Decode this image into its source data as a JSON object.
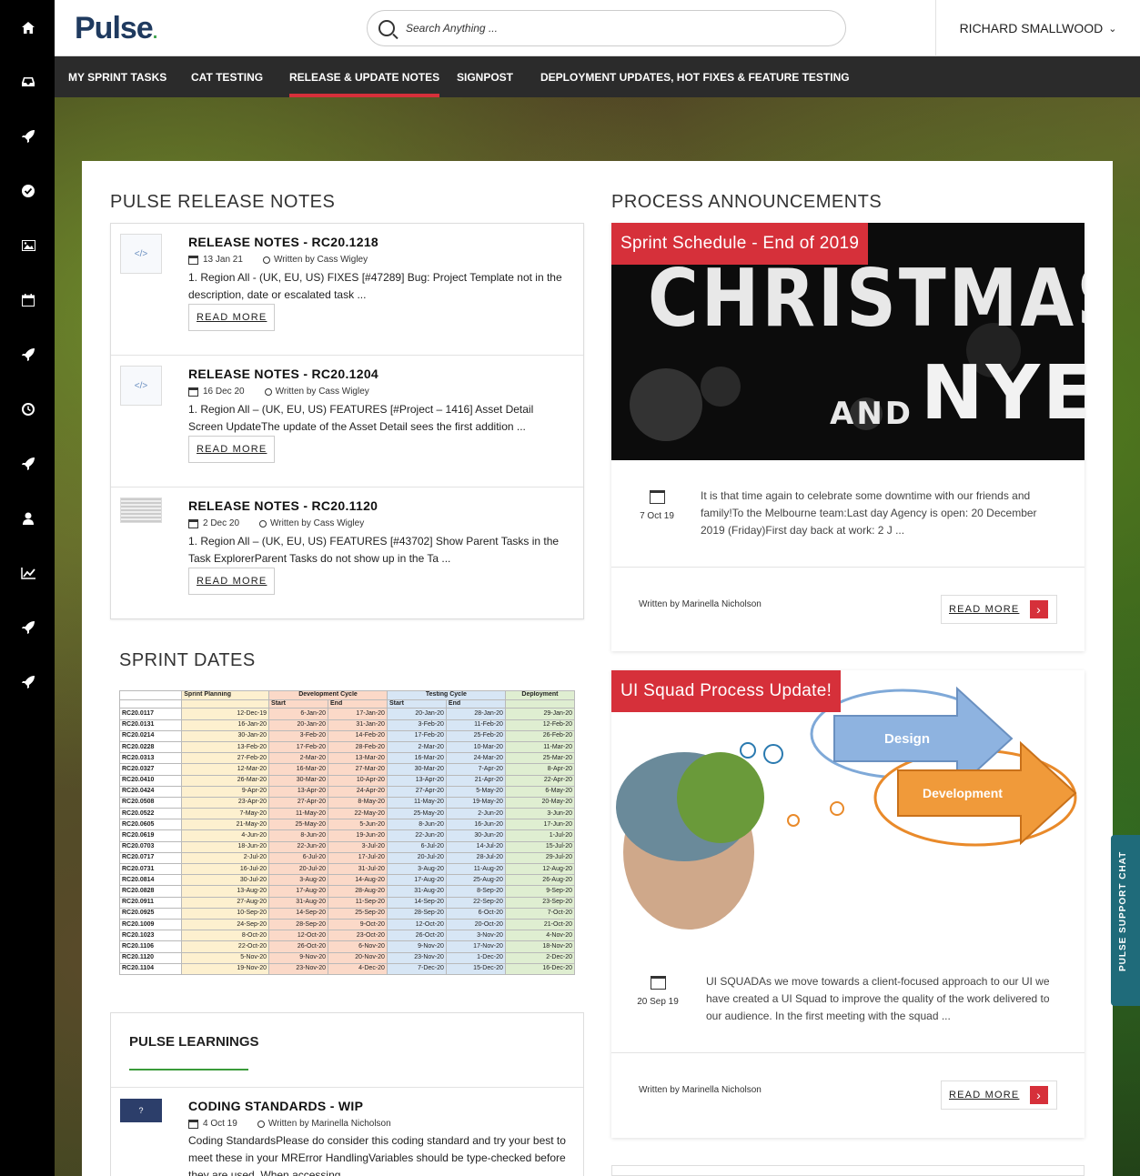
{
  "app": {
    "logo": "Pulse"
  },
  "search": {
    "placeholder": "Search Anything ..."
  },
  "user": {
    "name": "RICHARD SMALLWOOD"
  },
  "nav": {
    "items": [
      {
        "label": "MY SPRINT TASKS"
      },
      {
        "label": "CAT TESTING"
      },
      {
        "label": "RELEASE & UPDATE NOTES"
      },
      {
        "label": "SIGNPOST"
      },
      {
        "label": "DEPLOYMENT UPDATES, HOT FIXES & FEATURE TESTING"
      }
    ],
    "active_index": 2
  },
  "rail": {
    "icons": [
      "home-icon",
      "inbox-icon",
      "rocket-icon",
      "check-circle-icon",
      "image-icon",
      "calendar-icon",
      "rocket-icon",
      "clock-icon",
      "rocket-icon",
      "user-icon",
      "chart-line-icon",
      "rocket-icon",
      "rocket-icon"
    ]
  },
  "release_notes": {
    "title": "PULSE RELEASE NOTES",
    "read_more": "READ MORE",
    "items": [
      {
        "title": "RELEASE NOTES - RC20.1218",
        "date": "13 Jan 21",
        "author": "Written by Cass Wigley",
        "excerpt": "1. Region All - (UK, EU, US)  FIXES  [#47289] Bug: Project Template not in the description, date or escalated task ..."
      },
      {
        "title": "RELEASE NOTES - RC20.1204",
        "date": "16 Dec 20",
        "author": "Written by Cass Wigley",
        "excerpt": "1. Region All – (UK, EU, US) FEATURES [#Project – 1416] Asset Detail Screen UpdateThe update of the Asset Detail sees the first addition ..."
      },
      {
        "title": "RELEASE NOTES - RC20.1120",
        "date": "2 Dec 20",
        "author": "Written by Cass Wigley",
        "excerpt": "1. Region All – (UK, EU, US) FEATURES [#43702] Show Parent Tasks in the Task ExplorerParent Tasks do not show up in the Ta ..."
      }
    ]
  },
  "sprint_dates": {
    "title": "SPRINT DATES",
    "headers": {
      "planning": "Sprint Planning",
      "dev": "Development Cycle",
      "testing": "Testing Cycle",
      "deployment": "Deployment",
      "start": "Start",
      "end": "End"
    },
    "rows": [
      [
        "RC20.0117",
        "12-Dec-19",
        "6-Jan-20",
        "17-Jan-20",
        "20-Jan-20",
        "28-Jan-20",
        "29-Jan-20"
      ],
      [
        "RC20.0131",
        "16-Jan-20",
        "20-Jan-20",
        "31-Jan-20",
        "3-Feb-20",
        "11-Feb-20",
        "12-Feb-20"
      ],
      [
        "RC20.0214",
        "30-Jan-20",
        "3-Feb-20",
        "14-Feb-20",
        "17-Feb-20",
        "25-Feb-20",
        "26-Feb-20"
      ],
      [
        "RC20.0228",
        "13-Feb-20",
        "17-Feb-20",
        "28-Feb-20",
        "2-Mar-20",
        "10-Mar-20",
        "11-Mar-20"
      ],
      [
        "RC20.0313",
        "27-Feb-20",
        "2-Mar-20",
        "13-Mar-20",
        "16-Mar-20",
        "24-Mar-20",
        "25-Mar-20"
      ],
      [
        "RC20.0327",
        "12-Mar-20",
        "16-Mar-20",
        "27-Mar-20",
        "30-Mar-20",
        "7-Apr-20",
        "8-Apr-20"
      ],
      [
        "RC20.0410",
        "26-Mar-20",
        "30-Mar-20",
        "10-Apr-20",
        "13-Apr-20",
        "21-Apr-20",
        "22-Apr-20"
      ],
      [
        "RC20.0424",
        "9-Apr-20",
        "13-Apr-20",
        "24-Apr-20",
        "27-Apr-20",
        "5-May-20",
        "6-May-20"
      ],
      [
        "RC20.0508",
        "23-Apr-20",
        "27-Apr-20",
        "8-May-20",
        "11-May-20",
        "19-May-20",
        "20-May-20"
      ],
      [
        "RC20.0522",
        "7-May-20",
        "11-May-20",
        "22-May-20",
        "25-May-20",
        "2-Jun-20",
        "3-Jun-20"
      ],
      [
        "RC20.0605",
        "21-May-20",
        "25-May-20",
        "5-Jun-20",
        "8-Jun-20",
        "16-Jun-20",
        "17-Jun-20"
      ],
      [
        "RC20.0619",
        "4-Jun-20",
        "8-Jun-20",
        "19-Jun-20",
        "22-Jun-20",
        "30-Jun-20",
        "1-Jul-20"
      ],
      [
        "RC20.0703",
        "18-Jun-20",
        "22-Jun-20",
        "3-Jul-20",
        "6-Jul-20",
        "14-Jul-20",
        "15-Jul-20"
      ],
      [
        "RC20.0717",
        "2-Jul-20",
        "6-Jul-20",
        "17-Jul-20",
        "20-Jul-20",
        "28-Jul-20",
        "29-Jul-20"
      ],
      [
        "RC20.0731",
        "16-Jul-20",
        "20-Jul-20",
        "31-Jul-20",
        "3-Aug-20",
        "11-Aug-20",
        "12-Aug-20"
      ],
      [
        "RC20.0814",
        "30-Jul-20",
        "3-Aug-20",
        "14-Aug-20",
        "17-Aug-20",
        "25-Aug-20",
        "26-Aug-20"
      ],
      [
        "RC20.0828",
        "13-Aug-20",
        "17-Aug-20",
        "28-Aug-20",
        "31-Aug-20",
        "8-Sep-20",
        "9-Sep-20"
      ],
      [
        "RC20.0911",
        "27-Aug-20",
        "31-Aug-20",
        "11-Sep-20",
        "14-Sep-20",
        "22-Sep-20",
        "23-Sep-20"
      ],
      [
        "RC20.0925",
        "10-Sep-20",
        "14-Sep-20",
        "25-Sep-20",
        "28-Sep-20",
        "6-Oct-20",
        "7-Oct-20"
      ],
      [
        "RC20.1009",
        "24-Sep-20",
        "28-Sep-20",
        "9-Oct-20",
        "12-Oct-20",
        "20-Oct-20",
        "21-Oct-20"
      ],
      [
        "RC20.1023",
        "8-Oct-20",
        "12-Oct-20",
        "23-Oct-20",
        "26-Oct-20",
        "3-Nov-20",
        "4-Nov-20"
      ],
      [
        "RC20.1106",
        "22-Oct-20",
        "26-Oct-20",
        "6-Nov-20",
        "9-Nov-20",
        "17-Nov-20",
        "18-Nov-20"
      ],
      [
        "RC20.1120",
        "5-Nov-20",
        "9-Nov-20",
        "20-Nov-20",
        "23-Nov-20",
        "1-Dec-20",
        "2-Dec-20"
      ],
      [
        "RC20.1104",
        "19-Nov-20",
        "23-Nov-20",
        "4-Dec-20",
        "7-Dec-20",
        "15-Dec-20",
        "16-Dec-20"
      ]
    ]
  },
  "learnings": {
    "title": "PULSE LEARNINGS",
    "item": {
      "title": "CODING STANDARDS - WIP",
      "date": "4 Oct 19",
      "author": "Written by Marinella Nicholson",
      "excerpt": "Coding StandardsPlease do consider this coding standard and try your best to meet these in your MRError HandlingVariables should be type-checked before they are used. When accessing ..."
    }
  },
  "announcements": {
    "title": "PROCESS ANNOUNCEMENTS",
    "read_more": "READ MORE",
    "items": [
      {
        "tag": "Sprint Schedule - End of 2019",
        "image_words": [
          "CHRISTMAS",
          "AND",
          "NYE"
        ],
        "date": "7 Oct 19",
        "excerpt": "It is that time again to celebrate some downtime with our friends and family!To the Melbourne team:Last day Agency is open: 20 December 2019 (Friday)First day back at work: 2 J ...",
        "author": "Written by Marinella Nicholson"
      },
      {
        "tag": "UI Squad Process Update!",
        "image_words": [
          "Design",
          "Development"
        ],
        "date": "20 Sep 19",
        "excerpt": "UI SQUADAs we move towards a client-focused approach to our UI we have created a UI Squad to improve the quality of the work delivered to our audience. In the first meeting with the squad ...",
        "author": "Written by Marinella Nicholson"
      }
    ]
  },
  "chat": {
    "label": "PULSE SUPPORT CHAT"
  },
  "colors": {
    "accent": "#d6303a",
    "nav_bg": "#2b2b2b",
    "learn_line": "#3a9b3a"
  }
}
